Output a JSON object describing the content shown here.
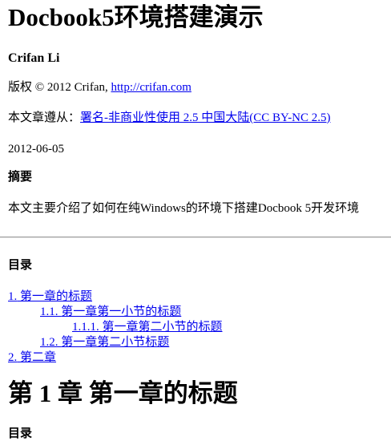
{
  "document": {
    "title": "Docbook5环境搭建演示",
    "author": "Crifan Li",
    "copyright": {
      "label": "版权",
      "text": "© 2012 Crifan,",
      "link": "http://crifan.com"
    },
    "license": {
      "prefix": "本文章遵从：",
      "link_text": "署名-非商业性使用 2.5 中国大陆(CC BY-NC 2.5)"
    },
    "date": "2012-06-05",
    "abstract": {
      "heading": "摘要",
      "body": "本文主要介绍了如何在纯Windows的环境下搭建Docbook 5开发环境"
    }
  },
  "toc": {
    "heading": "目录",
    "items": [
      {
        "number": "1.",
        "label": "第一章的标题"
      },
      {
        "number": "1.1.",
        "label": "第一章第一小节的标题"
      },
      {
        "number": "1.1.1.",
        "label": "第一章第二小节的标题"
      },
      {
        "number": "1.2.",
        "label": "第一章第二小节标题"
      },
      {
        "number": "2.",
        "label": "第二章"
      }
    ]
  },
  "chapter": {
    "prefix": "第",
    "number": "1",
    "suffix": "章",
    "title": "第一章的标题",
    "toc_heading": "目录"
  }
}
